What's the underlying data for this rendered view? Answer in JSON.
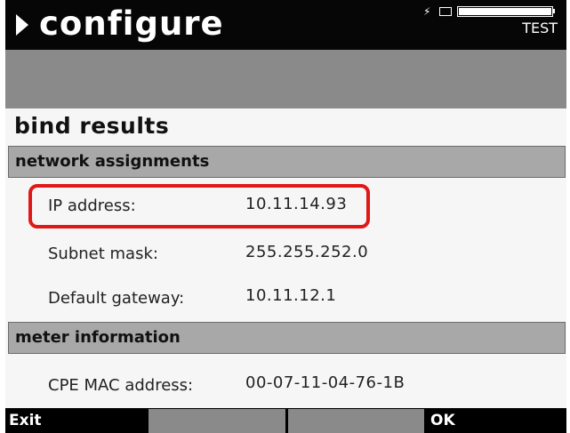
{
  "header": {
    "title": "configure",
    "status": {
      "mode_label": "TEST",
      "battery_level_fraction": 1.0,
      "plug_icon": "power-plug-icon",
      "connector_icon": "connector-icon",
      "battery_icon": "battery-icon"
    }
  },
  "page": {
    "heading": "bind results"
  },
  "network": {
    "section_title": "network assignments",
    "ip_label": "IP address:",
    "ip_value": "10.11.14.93",
    "subnet_label": "Subnet mask:",
    "subnet_value": "255.255.252.0",
    "gateway_label": "Default gateway:",
    "gateway_value": "10.11.12.1"
  },
  "meter": {
    "section_title": "meter information",
    "mac_label": "CPE MAC address:",
    "mac_value": "00-07-11-04-76-1B"
  },
  "softkeys": {
    "exit_label": "Exit",
    "ok_label": "OK"
  },
  "colors": {
    "title_bar": "#060606",
    "section_header": "#a8a8a8",
    "highlight": "#e01818",
    "softkey_blank": "#8a8a8a"
  }
}
